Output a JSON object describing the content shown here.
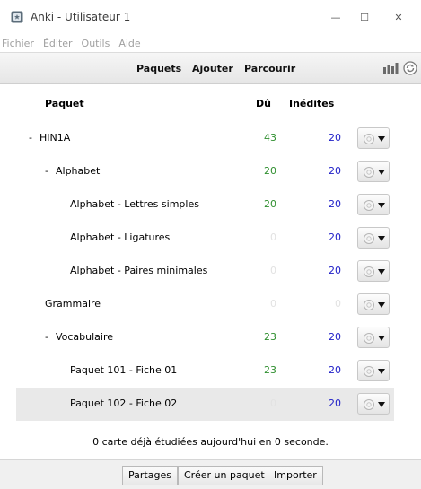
{
  "window": {
    "title": "Anki - Utilisateur 1",
    "minimize_glyph": "—",
    "maximize_glyph": "☐",
    "close_glyph": "✕"
  },
  "menu": {
    "items": [
      "Fichier",
      "Éditer",
      "Outils",
      "Aide"
    ]
  },
  "toolbar": {
    "decks": "Paquets",
    "add": "Ajouter",
    "browse": "Parcourir",
    "stats_icon": "stats-bars-icon",
    "sync_icon": "sync-icon"
  },
  "table": {
    "headers": {
      "deck": "Paquet",
      "due": "Dû",
      "new": "Inédites"
    },
    "rows": [
      {
        "collapse": "-",
        "name": "HIN1A",
        "due": "43",
        "new": "20",
        "due_zero": false,
        "new_zero": false,
        "level": 0,
        "current": false
      },
      {
        "collapse": "-",
        "name": "Alphabet",
        "due": "20",
        "new": "20",
        "due_zero": false,
        "new_zero": false,
        "level": 1,
        "current": false
      },
      {
        "collapse": "",
        "name": "Alphabet - Lettres simples",
        "due": "20",
        "new": "20",
        "due_zero": false,
        "new_zero": false,
        "level": 2,
        "current": false
      },
      {
        "collapse": "",
        "name": "Alphabet - Ligatures",
        "due": "0",
        "new": "20",
        "due_zero": true,
        "new_zero": false,
        "level": 2,
        "current": false
      },
      {
        "collapse": "",
        "name": "Alphabet - Paires minimales",
        "due": "0",
        "new": "20",
        "due_zero": true,
        "new_zero": false,
        "level": 2,
        "current": false
      },
      {
        "collapse": "",
        "name": "Grammaire",
        "due": "0",
        "new": "0",
        "due_zero": true,
        "new_zero": true,
        "level": 1,
        "current": false
      },
      {
        "collapse": "-",
        "name": "Vocabulaire",
        "due": "23",
        "new": "20",
        "due_zero": false,
        "new_zero": false,
        "level": 1,
        "current": false
      },
      {
        "collapse": "",
        "name": "Paquet 101 - Fiche 01",
        "due": "23",
        "new": "20",
        "due_zero": false,
        "new_zero": false,
        "level": 2,
        "current": false
      },
      {
        "collapse": "",
        "name": "Paquet 102 - Fiche 02",
        "due": "0",
        "new": "20",
        "due_zero": true,
        "new_zero": false,
        "level": 2,
        "current": true
      }
    ]
  },
  "studied_text": "0 carte déjà étudiées aujourd'hui en 0 seconde.",
  "bottom": {
    "shared": "Partages",
    "create": "Créer un paquet",
    "import": "Importer"
  },
  "colors": {
    "due": "#2f8f2f",
    "new": "#2020c8",
    "zero": "#e2e2e2",
    "current_row": "#e9e9e9"
  }
}
